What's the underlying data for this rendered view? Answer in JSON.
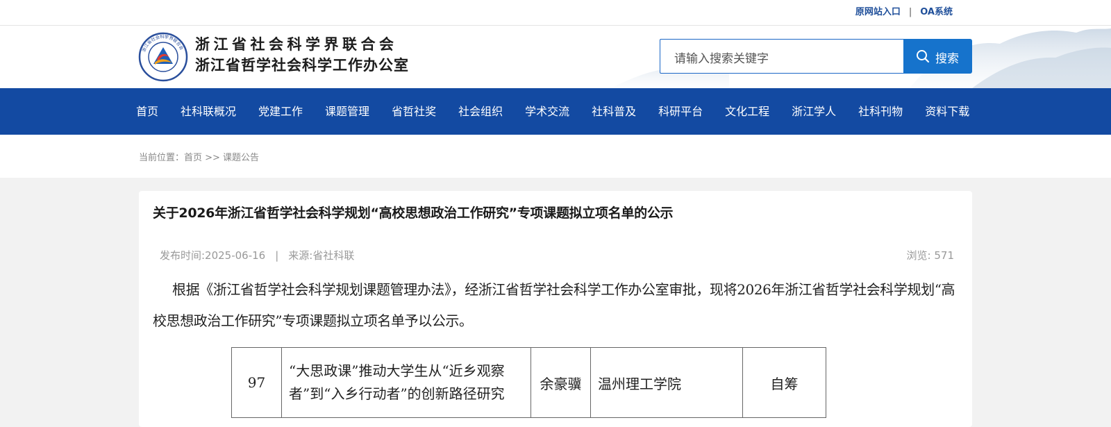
{
  "topbar": {
    "links": [
      "原网站入口",
      "OA系统"
    ],
    "separator": "|"
  },
  "header": {
    "org_name_line1": "浙江省社会科学界联合会",
    "org_name_line2": "浙江省哲学社会科学工作办公室",
    "logo_ring_text": "浙江省社会科学界联合会"
  },
  "search": {
    "placeholder": "请输入搜索关键字",
    "button_label": "搜索",
    "icon": "search-icon"
  },
  "nav": {
    "items": [
      "首页",
      "社科联概况",
      "党建工作",
      "课题管理",
      "省哲社奖",
      "社会组织",
      "学术交流",
      "社科普及",
      "科研平台",
      "文化工程",
      "浙江学人",
      "社科刊物",
      "资料下载"
    ]
  },
  "breadcrumb": {
    "text": "当前位置：首页 >> 课题公告"
  },
  "article": {
    "title": "关于2026年浙江省哲学社会科学规划“高校思想政治工作研究”专项课题拟立项名单的公示",
    "publish_time": "发布时间:2025-06-16",
    "meta_separator": "|",
    "source": "来源:省社科联",
    "views": "浏览: 571",
    "paragraph": "根据《浙江省哲学社会科学规划课题管理办法》，经浙江省哲学社会科学工作办公室审批，现将2026年浙江省哲学社会科学规划“高校思想政治工作研究”专项课题拟立项名单予以公示。",
    "table_rows": [
      {
        "no": "97",
        "topic": "“大思政课”推动大学生从“近乡观察者”到“入乡行动者”的创新路径研究",
        "leader": "余豪骥",
        "institution": "温州理工学院",
        "funding": "自筹"
      }
    ]
  },
  "colors": {
    "nav_bg": "#134aa2",
    "search_button": "#1673cc",
    "toplink": "#1f4f9a"
  }
}
